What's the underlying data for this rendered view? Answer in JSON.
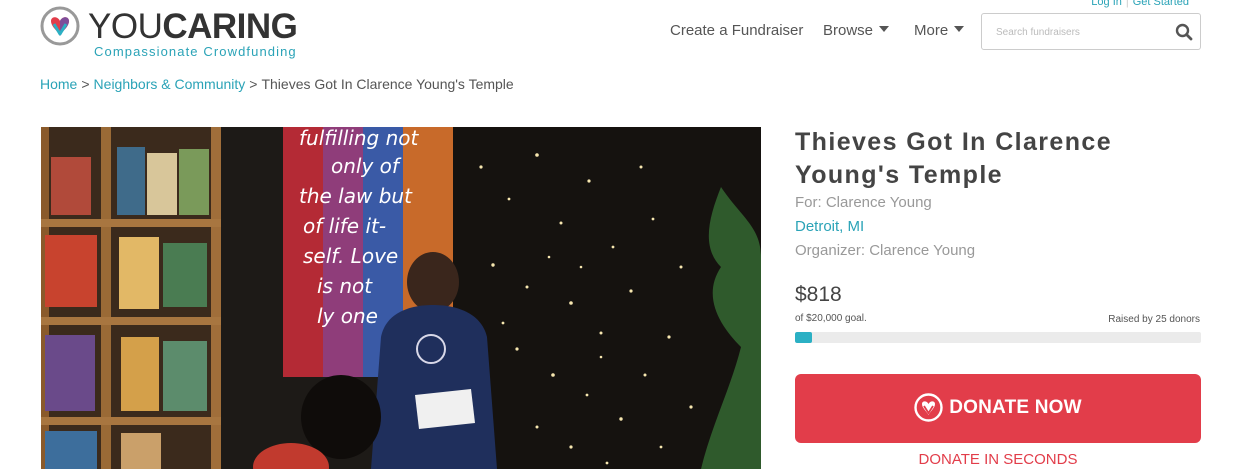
{
  "brand": {
    "word_light": "YOU",
    "word_bold": "CARING",
    "tagline": "Compassionate Crowdfunding",
    "logo_icon": "heart-hands-icon",
    "accent_color": "#2aa3b7",
    "donate_color": "#e23d4a"
  },
  "auth": {
    "login": "Log In",
    "get_started": "Get Started"
  },
  "nav": {
    "create": "Create a Fundraiser",
    "browse": "Browse",
    "more": "More"
  },
  "search": {
    "placeholder": "Search fundraisers",
    "icon": "search-icon"
  },
  "breadcrumb": {
    "home": "Home",
    "category": "Neighbors & Community",
    "current": "Thieves Got In Clarence Young's Temple",
    "separator": ">"
  },
  "campaign": {
    "title": "Thieves Got In Clarence Young's Temple",
    "for": "For: Clarence Young",
    "location": "Detroit, MI",
    "organizer": "Organizer: Clarence Young",
    "raised": "$818",
    "goal": "of $20,000 goal.",
    "donors": "Raised by 25 donors",
    "progress_fraction": 0.041
  },
  "donate": {
    "label": "DONATE NOW",
    "icon": "heart-hands-icon",
    "seconds": "DONATE IN SECONDS"
  },
  "hero": {
    "alt": "Man reading aloud in a bookstore in front of a painted canvas and string lights",
    "mural_lines": [
      "fulfilling not",
      "only of",
      "the law but",
      "of life it-",
      "self. Love",
      "is not",
      "ly one"
    ]
  }
}
